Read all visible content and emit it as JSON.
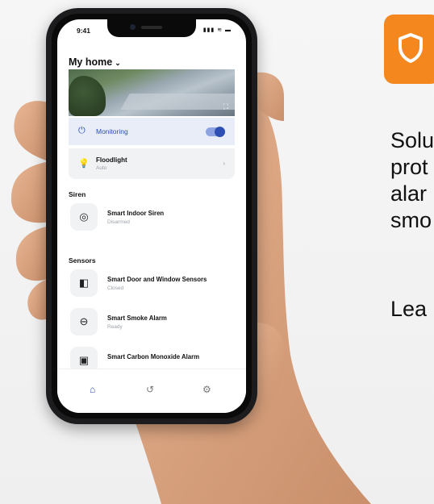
{
  "status_bar": {
    "time": "9:41",
    "icons": "▮▮▮ ≋ ▬"
  },
  "app": {
    "home_title": "My home",
    "home_chevron": "⌄",
    "camera": {
      "fullscreen_icon": "⛶"
    },
    "monitoring": {
      "label": "Monitoring",
      "enabled": true,
      "icon": "⏻"
    },
    "floodlight": {
      "label": "Floodlight",
      "sub": "Auto",
      "icon": "💡",
      "arrow": "›"
    },
    "sections": {
      "siren": "Siren",
      "sensors": "Sensors"
    },
    "devices": [
      {
        "name": "Smart Indoor Siren",
        "status": "Disarmed",
        "icon": "◎"
      },
      {
        "name": "Smart Door and Window Sensors",
        "status": "Closed",
        "icon": "◧"
      },
      {
        "name": "Smart Smoke Alarm",
        "status": "Ready",
        "icon": "⊖"
      },
      {
        "name": "Smart Carbon Monoxide Alarm",
        "status": "",
        "icon": "▣"
      }
    ],
    "nav": {
      "home_icon": "⌂",
      "history_icon": "↺",
      "settings_icon": "⚙"
    }
  },
  "promo": {
    "lines": [
      "Solu",
      "prot",
      "alar",
      "smo"
    ],
    "learn": "Lea",
    "accent": "#f5871f"
  }
}
